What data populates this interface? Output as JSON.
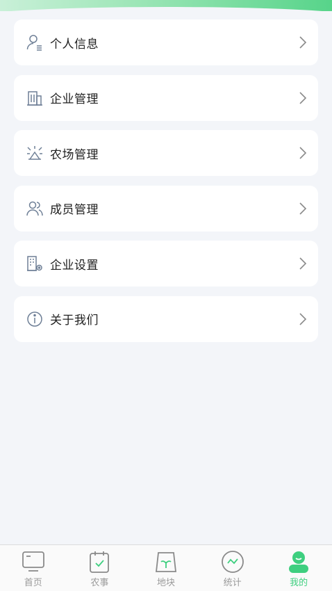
{
  "menu": {
    "items": [
      {
        "label": "个人信息",
        "icon": "user-profile-icon"
      },
      {
        "label": "企业管理",
        "icon": "building-icon"
      },
      {
        "label": "农场管理",
        "icon": "farm-icon"
      },
      {
        "label": "成员管理",
        "icon": "members-icon"
      },
      {
        "label": "企业设置",
        "icon": "enterprise-settings-icon"
      },
      {
        "label": "关于我们",
        "icon": "info-icon"
      }
    ]
  },
  "tabbar": {
    "tabs": [
      {
        "label": "首页",
        "icon": "home-icon",
        "active": false
      },
      {
        "label": "农事",
        "icon": "calendar-check-icon",
        "active": false
      },
      {
        "label": "地块",
        "icon": "land-plot-icon",
        "active": false
      },
      {
        "label": "统计",
        "icon": "statistics-icon",
        "active": false
      },
      {
        "label": "我的",
        "icon": "mine-icon",
        "active": true
      }
    ]
  },
  "colors": {
    "accent": "#3ecf7f",
    "icon_gray": "#6e7f96",
    "background": "#f3f5f9"
  }
}
